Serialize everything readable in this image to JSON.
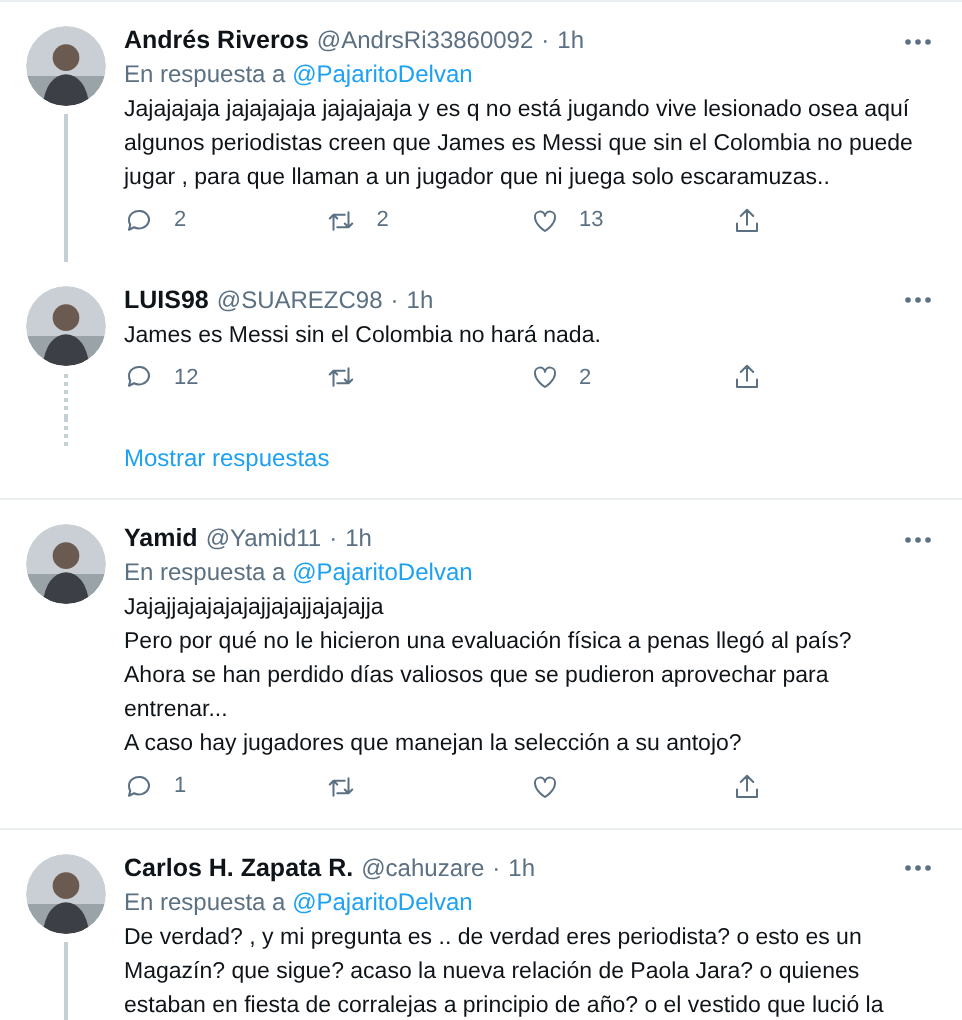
{
  "tweets": [
    {
      "name": "Andrés Riveros",
      "handle": "@AndrsRi33860092",
      "separator": "·",
      "time": "1h",
      "reply_to_label": "En respuesta a",
      "reply_to": "@PajaritoDelvan",
      "paragraphs": [
        "Jajajajaja jajajajaja jajajajaja y es q no está jugando vive lesionado osea aquí algunos periodistas creen que James es Messi que sin el Colombia no puede jugar , para que llaman a un jugador que ni juega solo escaramuzas.."
      ],
      "replies": "2",
      "retweets": "2",
      "likes": "13",
      "threaded": true
    },
    {
      "name": "LUIS98",
      "handle": "@SUAREZC98",
      "separator": "·",
      "time": "1h",
      "paragraphs": [
        "James es Messi sin el Colombia no hará nada."
      ],
      "replies": "12",
      "likes": "2",
      "threaded": true,
      "show_replies": "Mostrar respuestas"
    },
    {
      "name": "Yamid",
      "handle": "@Yamid11",
      "separator": "·",
      "time": "1h",
      "reply_to_label": "En respuesta a",
      "reply_to": "@PajaritoDelvan",
      "paragraphs": [
        "Jajajjajajajajajjajajjajajajja",
        "Pero por qué no le hicieron una evaluación física a penas llegó al país?",
        "Ahora se han perdido días valiosos que se pudieron aprovechar para entrenar...",
        "A caso hay jugadores que manejan la selección a su antojo?"
      ],
      "replies": "1",
      "threaded": false
    },
    {
      "name": "Carlos H. Zapata R.",
      "handle": "@cahuzare",
      "separator": "·",
      "time": "1h",
      "reply_to_label": "En respuesta a",
      "reply_to": "@PajaritoDelvan",
      "paragraphs": [
        "De verdad? , y  mi pregunta es .. de verdad eres periodista? o esto es un Magazín? que sigue? acaso la nueva relación de Paola Jara? o quienes estaban en fiesta de corralejas a principio de año? o el vestido que lució la"
      ],
      "threaded": true
    }
  ]
}
